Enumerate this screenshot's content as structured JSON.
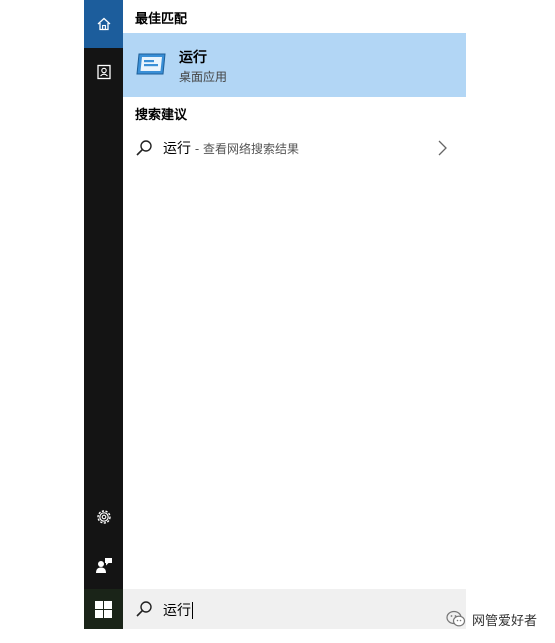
{
  "sidebar": {
    "items": [
      {
        "icon": "home-icon"
      },
      {
        "icon": "documents-icon"
      },
      {
        "icon": "gear-icon"
      },
      {
        "icon": "feedback-icon"
      }
    ],
    "active_color": "#1c5d9c"
  },
  "results": {
    "best_match_header": "最佳匹配",
    "best_match": {
      "title": "运行",
      "subtitle": "桌面应用",
      "icon": "run-app-icon"
    },
    "suggestions_header": "搜索建议",
    "suggestion": {
      "query": "运行",
      "hint": " - 查看网络搜索结果"
    }
  },
  "search": {
    "value": "运行"
  },
  "watermark": {
    "text": "网管爱好者"
  },
  "colors": {
    "selection": "#b2d6f5",
    "sidebar": "#141414",
    "accent": "#1c5d9c"
  }
}
